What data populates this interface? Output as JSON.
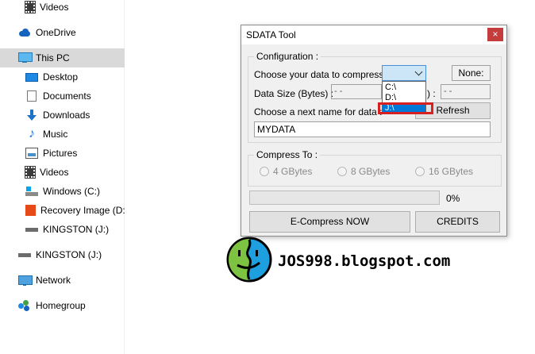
{
  "nav": {
    "items": [
      {
        "label": "Videos",
        "icon": "film-icon"
      },
      {
        "label": "OneDrive",
        "icon": "onedrive-cloud-icon"
      },
      {
        "label": "This PC",
        "icon": "this-pc-icon",
        "selected": true
      },
      {
        "label": "Desktop",
        "icon": "desktop-icon"
      },
      {
        "label": "Documents",
        "icon": "documents-icon"
      },
      {
        "label": "Downloads",
        "icon": "downloads-icon"
      },
      {
        "label": "Music",
        "icon": "music-icon"
      },
      {
        "label": "Pictures",
        "icon": "pictures-icon"
      },
      {
        "label": "Videos",
        "icon": "film-icon"
      },
      {
        "label": "Windows (C:)",
        "icon": "windows-drive-icon"
      },
      {
        "label": "Recovery Image (D:",
        "icon": "office-drive-icon"
      },
      {
        "label": "KINGSTON (J:)",
        "icon": "usb-drive-icon"
      },
      {
        "label": "KINGSTON (J:)",
        "icon": "usb-drive-icon"
      },
      {
        "label": "Network",
        "icon": "network-icon"
      },
      {
        "label": "Homegroup",
        "icon": "homegroup-icon"
      }
    ]
  },
  "dialog": {
    "title": "SDATA Tool",
    "close_glyph": "×",
    "config": {
      "title": "Configuration :",
      "choose_label": "Choose your data to compress :",
      "combo_value": "",
      "dropdown_options": [
        "C:\\",
        "D:\\",
        "J:\\"
      ],
      "selected_option": "J:\\",
      "none_label": "None:",
      "size_label": "Data Size (Bytes) :",
      "size_value": "- -",
      "size_value2": "- -",
      "size_paren": ") :",
      "next_name_label": "Choose a next name for data :",
      "refresh_label": "Refresh",
      "name_value": "MYDATA"
    },
    "compress": {
      "title": "Compress To :",
      "options": [
        "4 GBytes",
        "8 GBytes",
        "16 GBytes"
      ]
    },
    "progress": {
      "value": 0,
      "label": "0%"
    },
    "buttons": {
      "ecompress": "E-Compress NOW",
      "credits": "CREDITS"
    }
  },
  "watermark": {
    "text": "JOS998.blogspot.com"
  },
  "colors": {
    "accent": "#0078d7",
    "progress": "#06b025",
    "close": "#c43c3c",
    "highlight": "#d92020"
  }
}
